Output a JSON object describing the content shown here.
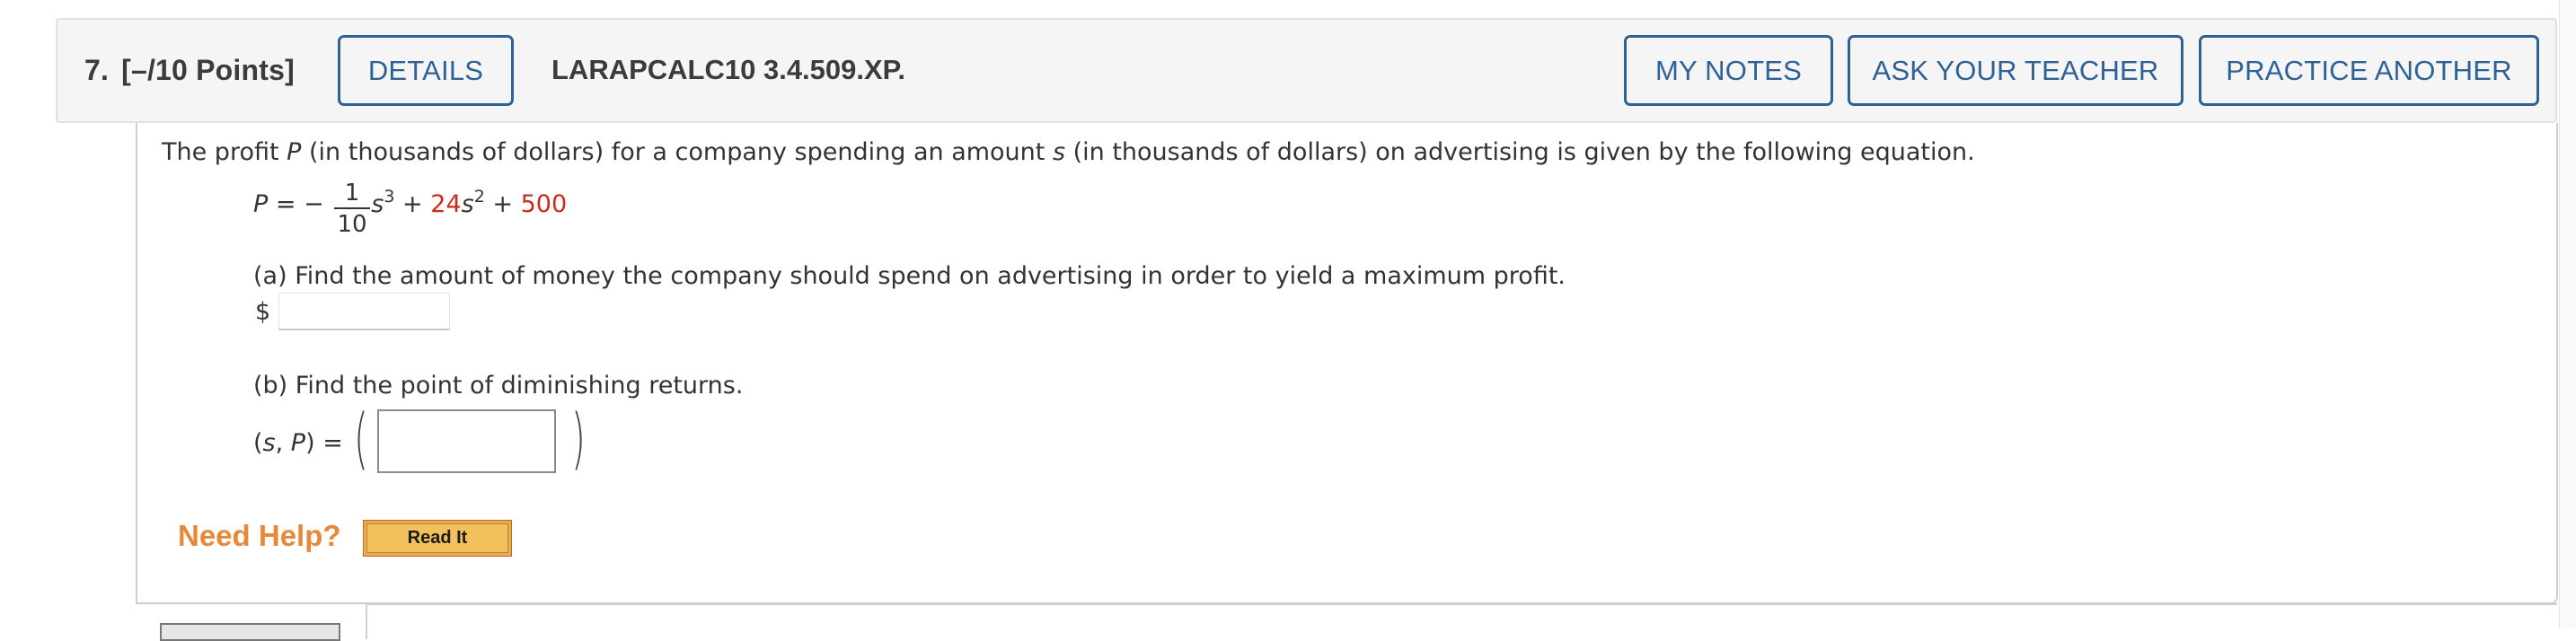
{
  "header": {
    "question_number": "7.",
    "points": "[–/10 Points]",
    "details_button": "DETAILS",
    "problem_code": "LARAPCALC10 3.4.509.XP.",
    "my_notes_button": "MY NOTES",
    "ask_teacher_button": "ASK YOUR TEACHER",
    "practice_another_button": "PRACTICE ANOTHER"
  },
  "problem": {
    "intro_part1": "The profit ",
    "var_P": "P",
    "intro_part2": " (in thousands of dollars) for a company spending an amount ",
    "var_s": "s",
    "intro_part3": " (in thousands of dollars) on advertising is given by the following equation.",
    "equation": {
      "lhs": "P",
      "equals_minus": " = − ",
      "frac_num": "1",
      "frac_den": "10",
      "term1_var": "s",
      "term1_exp": "3",
      "plus1": " + ",
      "coef2": "24",
      "term2_var": "s",
      "term2_exp": "2",
      "plus2": " + ",
      "constant": "500"
    },
    "part_a": {
      "question": "(a) Find the amount of money the company should spend on advertising in order to yield a maximum profit.",
      "currency_symbol": "$",
      "answer_value": ""
    },
    "part_b": {
      "question": "(b) Find the point of diminishing returns.",
      "label_open": "(",
      "label_s": "s",
      "label_comma": ", ",
      "label_P": "P",
      "label_close": ") =",
      "left_paren": "(",
      "right_paren": ")",
      "answer_value": ""
    }
  },
  "help": {
    "need_help_label": "Need Help?",
    "read_it_button": "Read It"
  },
  "colors": {
    "button_blue": "#2e6296",
    "highlight_red": "#cc2a1f",
    "need_help_orange": "#e8893a",
    "read_it_yellow": "#f3c15c"
  }
}
